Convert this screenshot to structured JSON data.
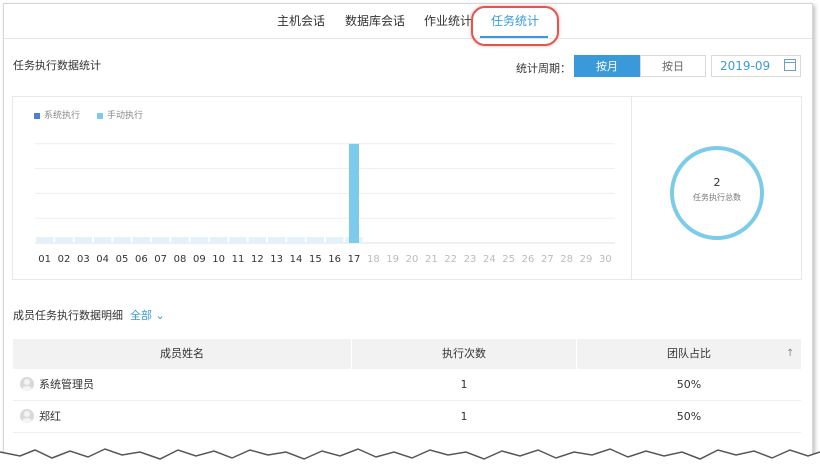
{
  "tabs": [
    {
      "label": "主机会话"
    },
    {
      "label": "数据库会话"
    },
    {
      "label": "作业统计"
    },
    {
      "label": "任务统计"
    }
  ],
  "active_tab": "任务统计",
  "accent": "#3a9ad9",
  "highlight_color": "#e0564c",
  "stats": {
    "title": "任务执行数据统计",
    "period_label": "统计周期：",
    "by_month": "按月",
    "by_day": "按日",
    "selected_period": "按月",
    "month_value": "2019-09",
    "calendar_icon": "calendar-icon"
  },
  "chart_data": {
    "type": "bar",
    "stacked": true,
    "categories": [
      "01",
      "02",
      "03",
      "04",
      "05",
      "06",
      "07",
      "08",
      "09",
      "10",
      "11",
      "12",
      "13",
      "14",
      "15",
      "16",
      "17",
      "18",
      "19",
      "20",
      "21",
      "22",
      "23",
      "24",
      "25",
      "26",
      "27",
      "28",
      "29",
      "30"
    ],
    "series": [
      {
        "name": "系统执行",
        "color": "#4a7fd6",
        "values": [
          0,
          0,
          0,
          0,
          0,
          0,
          0,
          0,
          0,
          0,
          0,
          0,
          0,
          0,
          0,
          0,
          0,
          0,
          0,
          0,
          0,
          0,
          0,
          0,
          0,
          0,
          0,
          0,
          0,
          0
        ]
      },
      {
        "name": "手动执行",
        "color": "#7ccbea",
        "values": [
          0,
          0,
          0,
          0,
          0,
          0,
          0,
          0,
          0,
          0,
          0,
          0,
          0,
          0,
          0,
          0,
          2,
          0,
          0,
          0,
          0,
          0,
          0,
          0,
          0,
          0,
          0,
          0,
          0,
          0
        ]
      }
    ],
    "ylim": [
      0,
      2.5
    ],
    "grid": true,
    "legend_position": "top-left",
    "future_tick_color": "#bbbbbb"
  },
  "total": {
    "value": "2",
    "label": "任务执行总数"
  },
  "detail": {
    "title": "成员任务执行数据明细",
    "filter_label": "全部",
    "filter_icon": "chevron-down-icon",
    "columns": [
      "成员姓名",
      "执行次数",
      "团队占比"
    ],
    "sort_icon": "sort-up-arrow-icon",
    "rows": [
      {
        "name": "系统管理员",
        "count": "1",
        "share": "50%"
      },
      {
        "name": "郑红",
        "count": "1",
        "share": "50%"
      }
    ]
  }
}
